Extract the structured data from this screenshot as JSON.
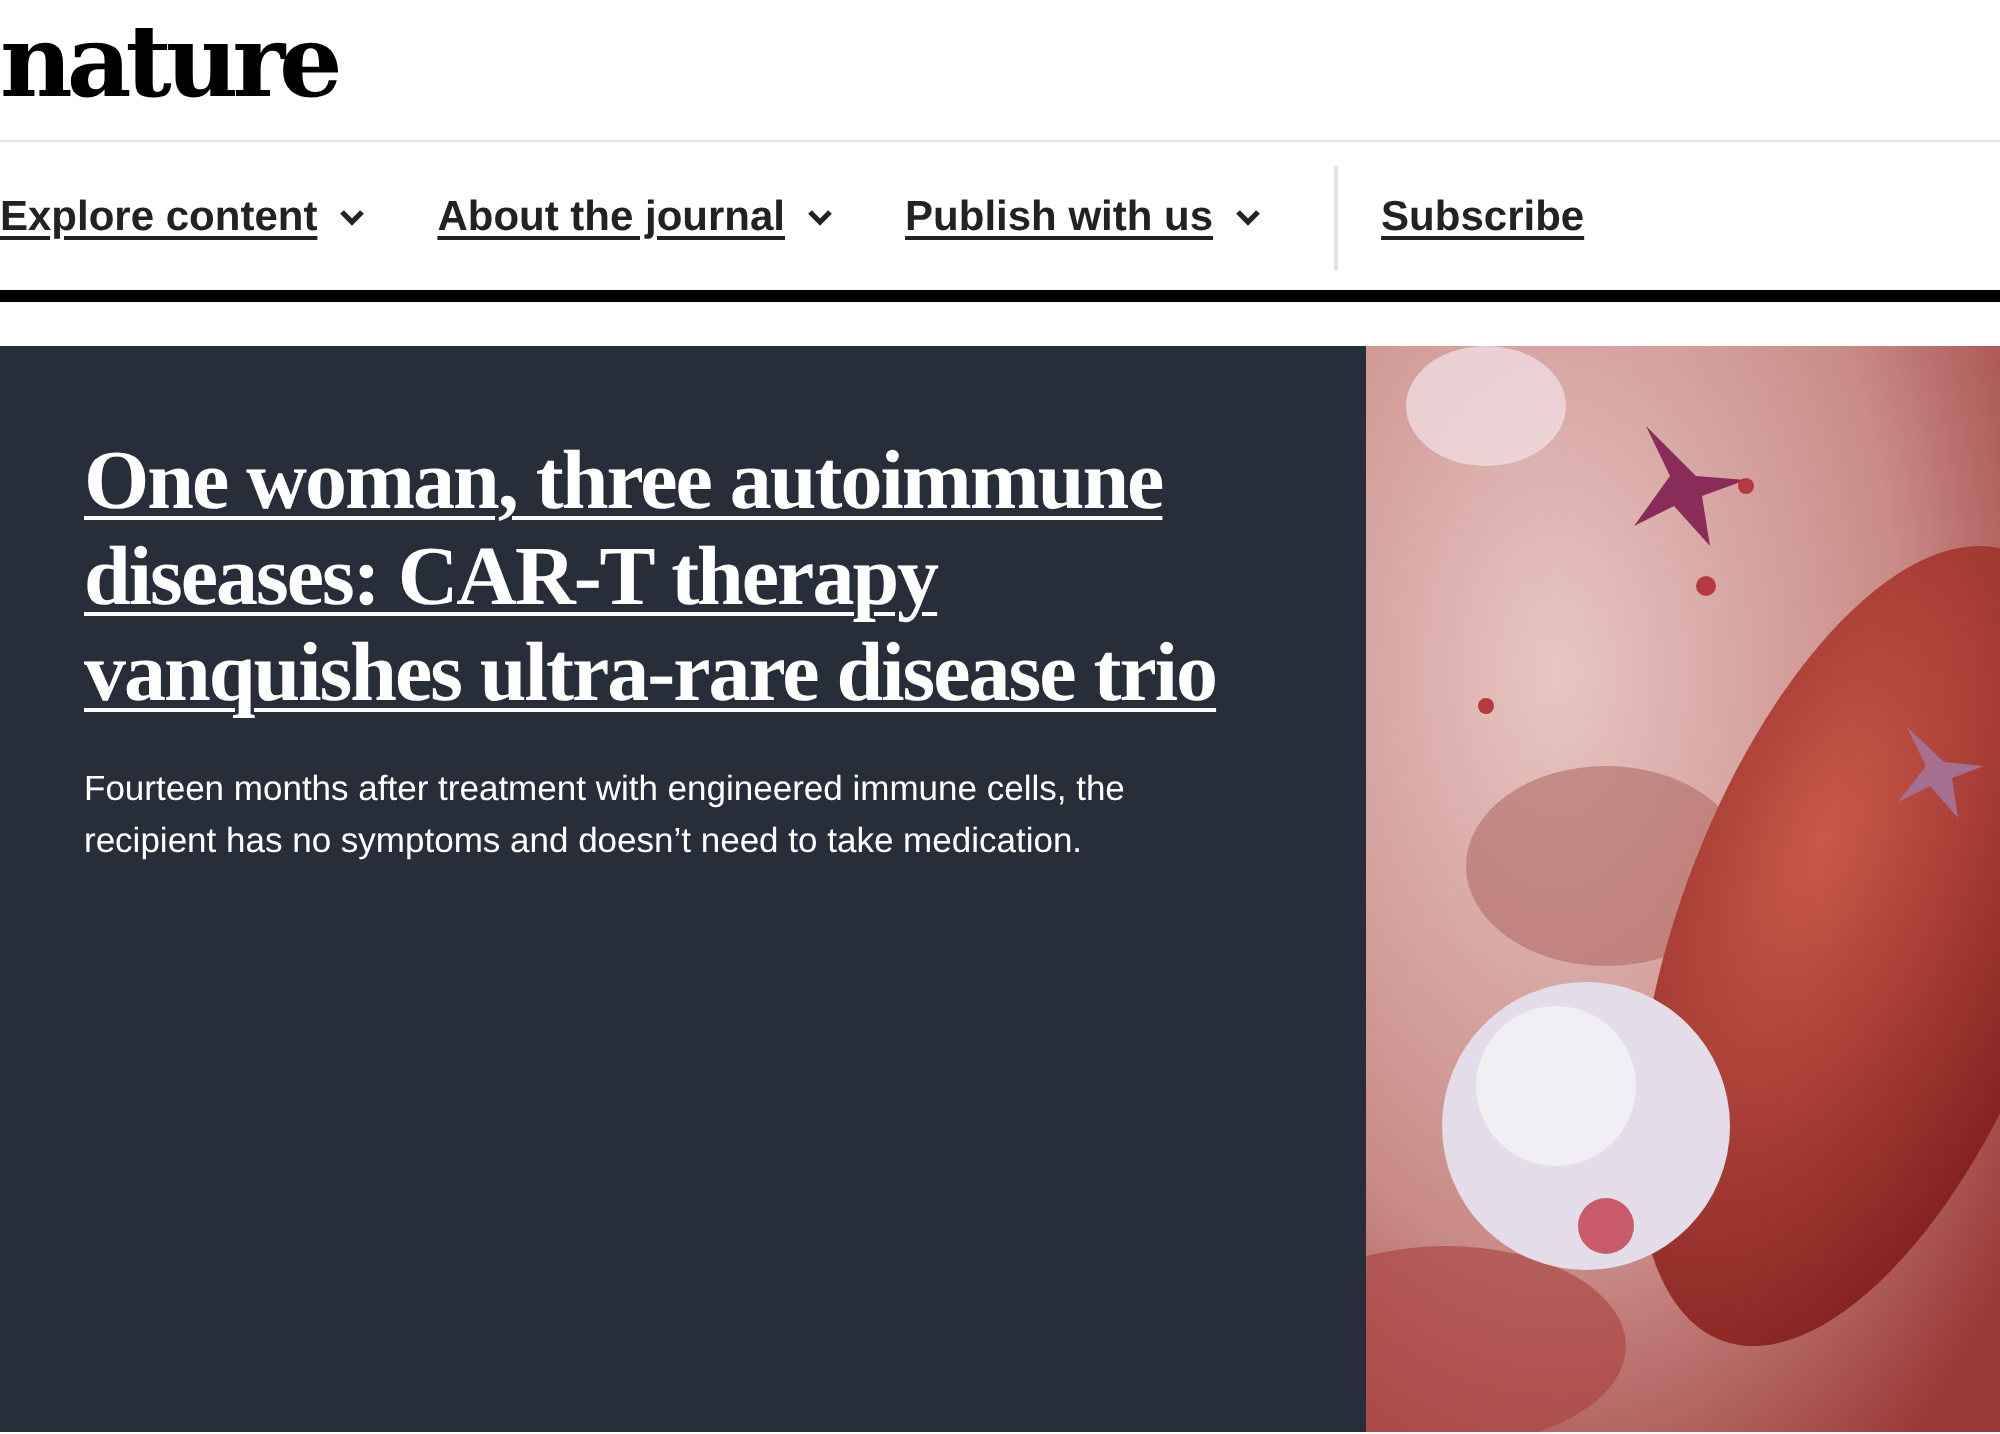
{
  "logo": {
    "text": "nature"
  },
  "nav": [
    {
      "label": "Explore content",
      "has_menu": true
    },
    {
      "label": "About the journal",
      "has_menu": true
    },
    {
      "label": "Publish with us",
      "has_menu": true
    },
    {
      "label": "Subscribe",
      "has_menu": false
    }
  ],
  "hero": {
    "headline": "One woman, three autoimmune diseases: CAR-T therapy vanquishes ultra-rare disease trio",
    "summary": "Fourteen months after treatment with engineered immune cells, the recipient has no symptoms and doesn’t need to take medication."
  }
}
